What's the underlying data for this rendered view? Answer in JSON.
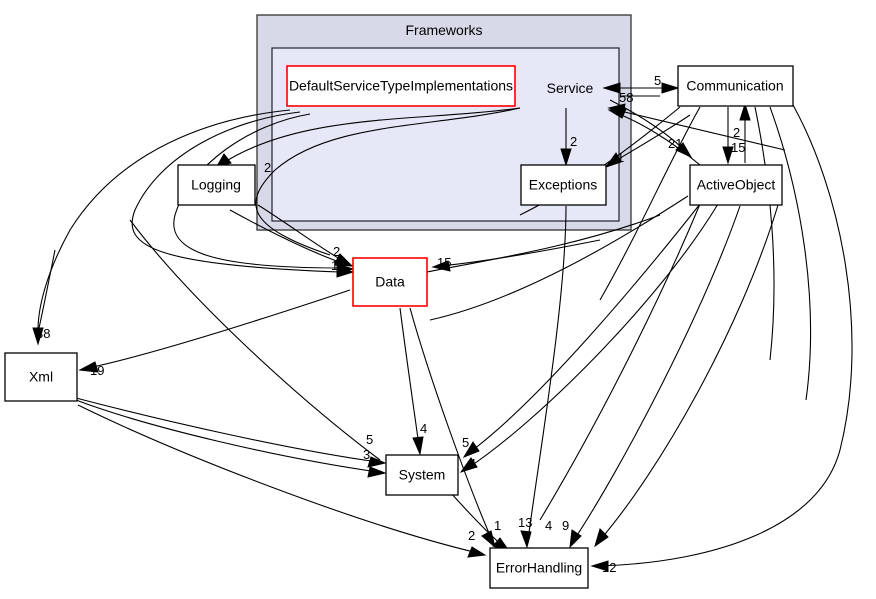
{
  "diagram": {
    "type": "dependency-graph",
    "clusters": [
      {
        "id": "frameworks",
        "label": "Frameworks"
      },
      {
        "id": "service",
        "label": "Service"
      }
    ],
    "nodes": [
      {
        "id": "defaultservicetypeimplementations",
        "label": "DefaultServiceTypeImplementations",
        "border": "#ff0000"
      },
      {
        "id": "logging",
        "label": "Logging",
        "border": "#000000"
      },
      {
        "id": "exceptions",
        "label": "Exceptions",
        "border": "#000000"
      },
      {
        "id": "communication",
        "label": "Communication",
        "border": "#000000"
      },
      {
        "id": "activeobject",
        "label": "ActiveObject",
        "border": "#000000"
      },
      {
        "id": "data",
        "label": "Data",
        "border": "#ff0000"
      },
      {
        "id": "xml",
        "label": "Xml",
        "border": "#000000"
      },
      {
        "id": "system",
        "label": "System",
        "border": "#000000"
      },
      {
        "id": "errorhandling",
        "label": "ErrorHandling",
        "border": "#000000"
      }
    ],
    "edge_labels": {
      "service_from_communication": "5",
      "service_in_58": "58",
      "service_to_exceptions": "2",
      "exceptions_in_1": "1",
      "logging_in_2": "2",
      "data_in_2": "2",
      "data_in_15_left": "15",
      "data_in_15_right": "15",
      "communication_to_activeobject": "2",
      "activeobject_to_communication": "15",
      "activeobject_in_21": "21",
      "xml_in_38": "38",
      "xml_in_19": "19",
      "system_in_5_left": "5",
      "system_in_3": "3",
      "system_in_4": "4",
      "system_in_5_right": "5",
      "system_in_1": "1",
      "errorhandling_in_2": "2",
      "errorhandling_in_1": "1",
      "errorhandling_in_13": "13",
      "errorhandling_in_4": "4",
      "errorhandling_in_9": "9",
      "errorhandling_in_12": "12"
    },
    "colors": {
      "cluster_outer_fill": "#d7d9e8",
      "cluster_inner_fill": "#e6e8f8",
      "node_fill": "#ffffff",
      "highlight_border": "#ff0000",
      "edge_stroke": "#000000"
    }
  }
}
